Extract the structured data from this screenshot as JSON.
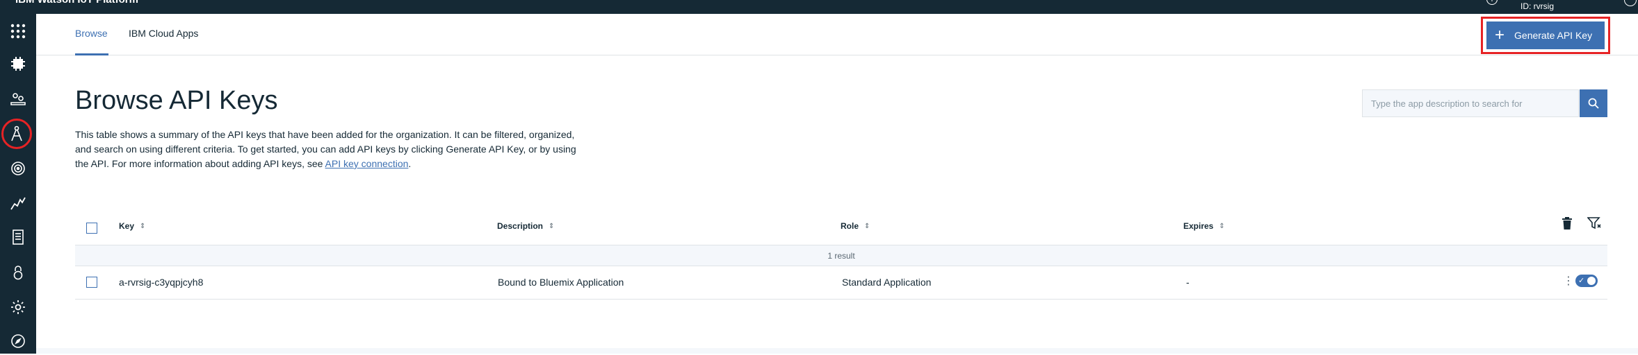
{
  "topbar": {
    "product": "IBM Watson IoT Platform",
    "org_id": "ID: rvrsig"
  },
  "sidebar": {
    "items": [
      {
        "icon": "app-grid-icon"
      },
      {
        "icon": "devices-icon"
      },
      {
        "icon": "members-icon"
      },
      {
        "icon": "apps-icon",
        "active": true
      },
      {
        "icon": "analytics-icon"
      },
      {
        "icon": "rules-icon"
      },
      {
        "icon": "reports-icon"
      },
      {
        "icon": "security-icon"
      },
      {
        "icon": "settings-icon"
      },
      {
        "icon": "compass-icon"
      }
    ]
  },
  "tabs": [
    {
      "label": "Browse",
      "active": true
    },
    {
      "label": "IBM Cloud Apps",
      "active": false
    }
  ],
  "actions": {
    "generate_label": "Generate API Key"
  },
  "page": {
    "title": "Browse API Keys",
    "description_prefix": "This table shows a summary of the API keys that have been added for the organization. It can be filtered, organized, and search on using different criteria. To get started, you can add API keys by clicking Generate API Key, or by using the API. For more information about adding API keys, see ",
    "description_link": "API key connection",
    "description_suffix": "."
  },
  "search": {
    "placeholder": "Type the app description to search for"
  },
  "table": {
    "columns": [
      "Key",
      "Description",
      "Role",
      "Expires"
    ],
    "result_count": "1 result",
    "rows": [
      {
        "key": "a-rvrsig-c3yqpjcyh8",
        "description": "Bound to Bluemix Application",
        "role": "Standard Application",
        "expires": "-",
        "enabled": true
      }
    ]
  },
  "colors": {
    "accent": "#3d70b2",
    "sidebar": "#152935",
    "highlight": "#e62325"
  }
}
